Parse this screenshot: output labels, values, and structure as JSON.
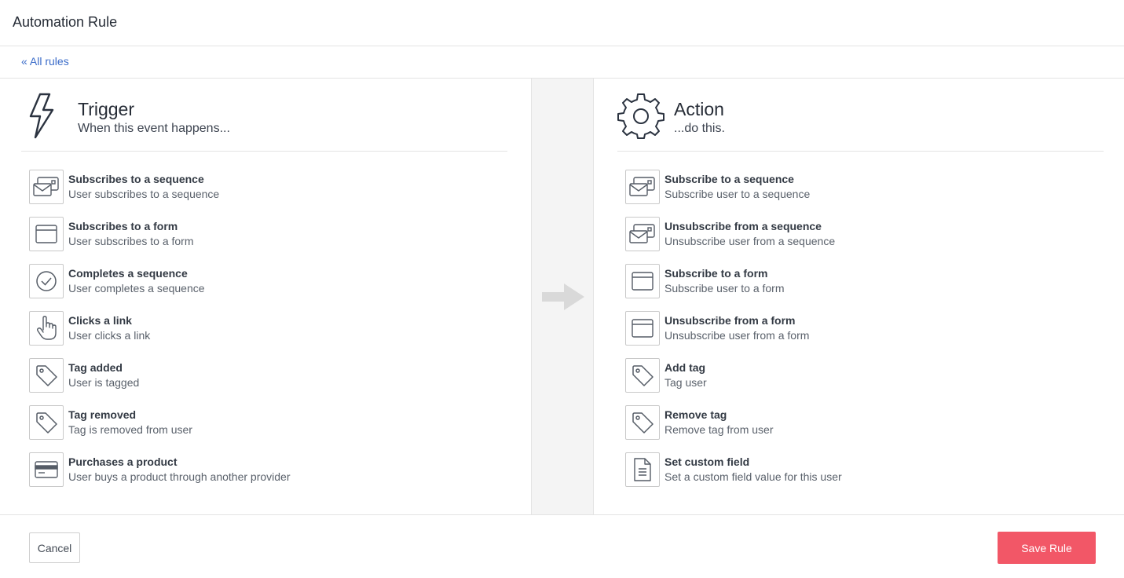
{
  "page_title": "Automation Rule",
  "breadcrumb": {
    "back_link": "« All rules"
  },
  "trigger": {
    "title": "Trigger",
    "subtitle": "When this event happens...",
    "icon": "lightning-icon",
    "items": [
      {
        "title": "Subscribes to a sequence",
        "desc": "User subscribes to a sequence",
        "icon": "sequence-icon"
      },
      {
        "title": "Subscribes to a form",
        "desc": "User subscribes to a form",
        "icon": "form-icon"
      },
      {
        "title": "Completes a sequence",
        "desc": "User completes a sequence",
        "icon": "check-circle-icon"
      },
      {
        "title": "Clicks a link",
        "desc": "User clicks a link",
        "icon": "pointer-hand-icon"
      },
      {
        "title": "Tag added",
        "desc": "User is tagged",
        "icon": "tag-icon"
      },
      {
        "title": "Tag removed",
        "desc": "Tag is removed from user",
        "icon": "tag-icon"
      },
      {
        "title": "Purchases a product",
        "desc": "User buys a product through another provider",
        "icon": "credit-card-icon"
      }
    ]
  },
  "action": {
    "title": "Action",
    "subtitle": "...do this.",
    "icon": "gear-icon",
    "items": [
      {
        "title": "Subscribe to a sequence",
        "desc": "Subscribe user to a sequence",
        "icon": "sequence-icon"
      },
      {
        "title": "Unsubscribe from a sequence",
        "desc": "Unsubscribe user from a sequence",
        "icon": "sequence-icon"
      },
      {
        "title": "Subscribe to a form",
        "desc": "Subscribe user to a form",
        "icon": "form-icon"
      },
      {
        "title": "Unsubscribe from a form",
        "desc": "Unsubscribe user from a form",
        "icon": "form-icon"
      },
      {
        "title": "Add tag",
        "desc": "Tag user",
        "icon": "tag-icon"
      },
      {
        "title": "Remove tag",
        "desc": "Remove tag from user",
        "icon": "tag-icon"
      },
      {
        "title": "Set custom field",
        "desc": "Set a custom field value for this user",
        "icon": "document-icon"
      }
    ]
  },
  "footer": {
    "cancel_label": "Cancel",
    "save_label": "Save Rule"
  },
  "colors": {
    "link": "#3b6cc9",
    "save_button": "#f25767",
    "arrow": "#d9d9d9",
    "icon_stroke": "#555c66"
  }
}
